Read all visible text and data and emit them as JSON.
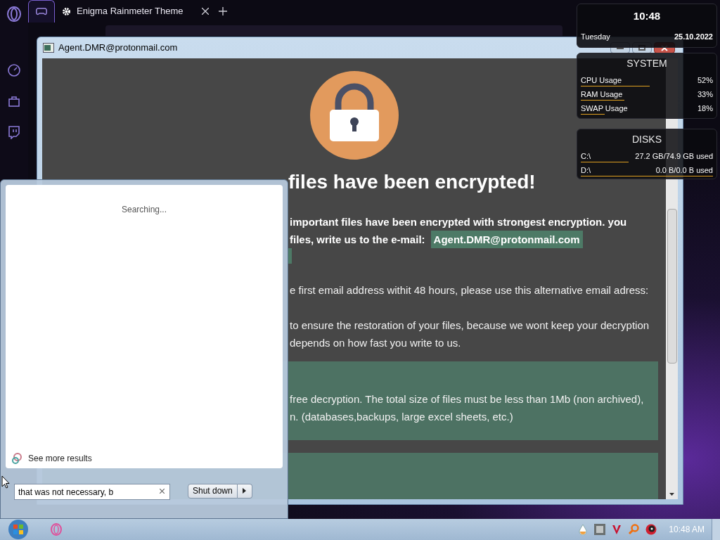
{
  "browser": {
    "tabs": [
      {
        "kind": "icon",
        "selected": true
      },
      {
        "kind": "page",
        "label": "Enigma Rainmeter Theme",
        "selected": false
      }
    ]
  },
  "ransom_window": {
    "title": "Agent.DMR@protonmail.com",
    "heading": "files have been encrypted!",
    "lines": [
      {
        "kind": "bold",
        "text": "important files have been encrypted with strongest encryption. you"
      },
      {
        "kind": "bold",
        "text": "files, write us to the e-mail:",
        "highlight": "Agent.DMR@protonmail.com"
      },
      {
        "kind": "plain",
        "text": "e first email address withit 48 hours, please use this alternative email adress:"
      },
      {
        "kind": "plain",
        "text": "to ensure the restoration of your files, because we wont keep your decryption"
      },
      {
        "kind": "plain",
        "text": "depends on how fast you write to us."
      }
    ],
    "notes": [
      {
        "kind": "text",
        "lines": [
          "free decryption. The total size of files must be less than 1Mb (non archived),",
          "n. (databases,backups, large excel sheets, etc.)"
        ]
      },
      {
        "kind": "blank"
      }
    ]
  },
  "widgets": {
    "clock": {
      "time": "10:48",
      "day": "Tuesday",
      "date": "25.10.2022"
    },
    "system": {
      "title": "SYSTEM",
      "rows": [
        {
          "label": "CPU Usage",
          "value": "52%",
          "level": 0.52
        },
        {
          "label": "RAM Usage",
          "value": "33%",
          "level": 0.33
        },
        {
          "label": "SWAP Usage",
          "value": "18%",
          "level": 0.18
        }
      ]
    },
    "disks": {
      "title": "DISKS",
      "rows": [
        {
          "label": "C:\\",
          "value": "27.2 GB/74.9 GB used",
          "level": 0.36
        },
        {
          "label": "D:\\",
          "value": "0.0 B/0.0 B used",
          "level": 1
        }
      ]
    }
  },
  "start_menu": {
    "status": "Searching...",
    "more_results": "See more results",
    "search": {
      "value": "that was not necessary, b"
    },
    "shutdown": "Shut down"
  },
  "taskbar": {
    "clock": "10:48 AM"
  }
}
